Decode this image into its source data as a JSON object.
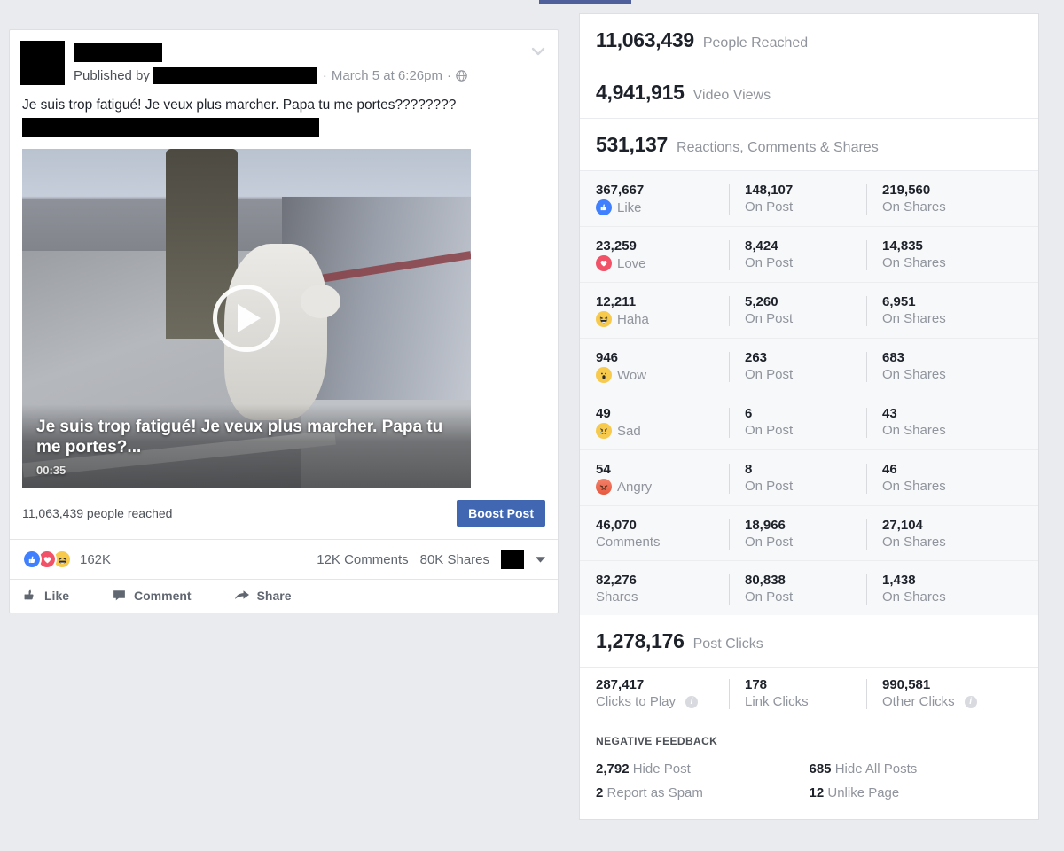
{
  "post": {
    "published_by_label": "Published by",
    "separator": "·",
    "date": "March 5 at 6:26pm",
    "privacy_icon": "globe-icon",
    "menu_icon": "chevron-down-icon",
    "message": "Je suis trop fatigué! Je veux plus marcher. Papa tu me portes????????",
    "video": {
      "title": "Je suis trop fatigué! Je veux plus marcher. Papa tu me portes?...",
      "duration": "00:35",
      "play_icon": "play-icon"
    },
    "reach_text": "11,063,439 people reached",
    "boost_label": "Boost Post",
    "reactions_total": "162K",
    "comments_count": "12K Comments",
    "shares_count": "80K Shares",
    "actions": [
      {
        "label": "Like",
        "icon": "thumbs-up-icon"
      },
      {
        "label": "Comment",
        "icon": "comment-bubble-icon"
      },
      {
        "label": "Share",
        "icon": "share-arrow-icon"
      }
    ]
  },
  "insights": {
    "summary": [
      {
        "value": "11,063,439",
        "label": "People Reached"
      },
      {
        "value": "4,941,915",
        "label": "Video Views"
      },
      {
        "value": "531,137",
        "label": "Reactions, Comments & Shares"
      }
    ],
    "breakdown_columns": [
      "",
      "On Post",
      "On Shares"
    ],
    "breakdown": [
      {
        "total": "367,667",
        "label": "Like",
        "icon": "like-icon",
        "glyph": "👍",
        "on_post": "148,107",
        "on_post_label": "On Post",
        "on_shares": "219,560",
        "on_shares_label": "On Shares"
      },
      {
        "total": "23,259",
        "label": "Love",
        "icon": "love-icon",
        "glyph": "♥",
        "on_post": "8,424",
        "on_post_label": "On Post",
        "on_shares": "14,835",
        "on_shares_label": "On Shares"
      },
      {
        "total": "12,211",
        "label": "Haha",
        "icon": "haha-icon",
        "glyph": "😆",
        "on_post": "5,260",
        "on_post_label": "On Post",
        "on_shares": "6,951",
        "on_shares_label": "On Shares"
      },
      {
        "total": "946",
        "label": "Wow",
        "icon": "wow-icon",
        "glyph": "😮",
        "on_post": "263",
        "on_post_label": "On Post",
        "on_shares": "683",
        "on_shares_label": "On Shares"
      },
      {
        "total": "49",
        "label": "Sad",
        "icon": "sad-icon",
        "glyph": "😢",
        "on_post": "6",
        "on_post_label": "On Post",
        "on_shares": "43",
        "on_shares_label": "On Shares"
      },
      {
        "total": "54",
        "label": "Angry",
        "icon": "angry-icon",
        "glyph": "😡",
        "on_post": "8",
        "on_post_label": "On Post",
        "on_shares": "46",
        "on_shares_label": "On Shares"
      },
      {
        "total": "46,070",
        "label": "Comments",
        "icon": "comments-icon",
        "glyph": "",
        "on_post": "18,966",
        "on_post_label": "On Post",
        "on_shares": "27,104",
        "on_shares_label": "On Shares"
      },
      {
        "total": "82,276",
        "label": "Shares",
        "icon": "shares-icon",
        "glyph": "",
        "on_post": "80,838",
        "on_post_label": "On Post",
        "on_shares": "1,438",
        "on_shares_label": "On Shares"
      }
    ],
    "post_clicks": {
      "value": "1,278,176",
      "label": "Post Clicks"
    },
    "clicks_breakdown": [
      {
        "value": "287,417",
        "label": "Clicks to Play",
        "has_info": true
      },
      {
        "value": "178",
        "label": "Link Clicks",
        "has_info": false
      },
      {
        "value": "990,581",
        "label": "Other Clicks",
        "has_info": true
      }
    ],
    "negative_feedback": {
      "heading": "NEGATIVE FEEDBACK",
      "items": [
        {
          "value": "2,792",
          "label": "Hide Post"
        },
        {
          "value": "685",
          "label": "Hide All Posts"
        },
        {
          "value": "2",
          "label": "Report as Spam"
        },
        {
          "value": "12",
          "label": "Unlike Page"
        }
      ]
    }
  },
  "colors": {
    "brand_blue": "#4267b2",
    "tab_indicator": "#4e5f9c",
    "like_blue": "#4080ff",
    "love_red": "#f25268",
    "haha_yellow": "#f7ca4d",
    "angry_orange": "#e9573f",
    "page_bg": "#e9ebee",
    "table_bg": "#f7f8f9"
  }
}
